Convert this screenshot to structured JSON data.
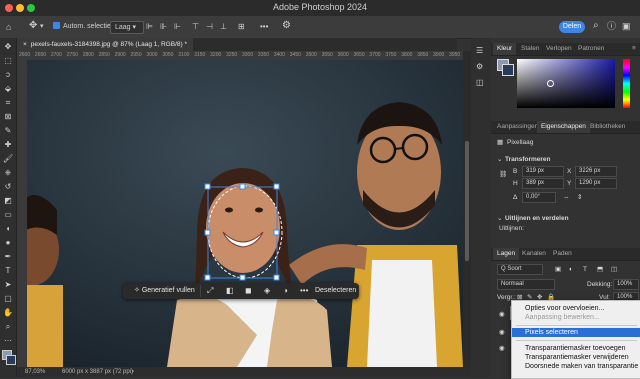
{
  "window": {
    "title": "Adobe Photoshop 2024"
  },
  "options_bar": {
    "auto_select_label": "Autom. selectie:",
    "layer_select_value": "Laag",
    "more_label": "•••",
    "share_label": "Delen"
  },
  "document": {
    "tab_title": "pexels-fauxels-3184398.jpg @ 87% (Laag 1, RGB/8) *",
    "zoom": "87,03%",
    "dimensions": "6000 px x 3887 px (72 ppi)",
    "ruler_marks": [
      "2600",
      "2650",
      "2700",
      "2750",
      "2800",
      "2850",
      "2900",
      "2950",
      "3000",
      "3050",
      "3100",
      "3150",
      "3200",
      "3250",
      "3300",
      "3350",
      "3400",
      "3450",
      "3500",
      "3550",
      "3600",
      "3650",
      "3700",
      "3750",
      "3800",
      "3850",
      "3900",
      "3950"
    ]
  },
  "contextual_task_bar": {
    "generate_label": "Generatief vullen",
    "deselect_label": "Deselecteren",
    "more_label": "•••"
  },
  "color_panel": {
    "tabs": [
      "Kleur",
      "Stalen",
      "Verlopen",
      "Patronen"
    ],
    "active_tab": "Kleur",
    "hue_color": "#1a1aa8"
  },
  "properties_panel": {
    "tabs": [
      "Aanpassingen",
      "Eigenschappen",
      "Bibliotheken"
    ],
    "active_tab": "Eigenschappen",
    "layer_type": "Pixellaag",
    "transform_header": "Transformeren",
    "w_label": "B",
    "w_value": "319 px",
    "h_label": "H",
    "h_value": "389 px",
    "x_label": "X",
    "x_value": "3226 px",
    "y_label": "Y",
    "y_value": "1290 px",
    "angle_label": "Δ",
    "angle_value": "0,00°",
    "align_header": "Uitlijnen en verdelen",
    "align_sub": "Uitlijnen:"
  },
  "layers_panel": {
    "tabs": [
      "Lagen",
      "Kanalen",
      "Paden"
    ],
    "active_tab": "Lagen",
    "filter_label": "Q Soort",
    "blend_mode": "Normaal",
    "opacity_label": "Dekking:",
    "opacity_value": "100%",
    "lock_label": "Vergr.:",
    "fill_label": "Vul:",
    "fill_value": "100%"
  },
  "context_menu": {
    "items": [
      {
        "label": "Opties voor overvloeien...",
        "state": "normal"
      },
      {
        "label": "Aanpassing bewerken...",
        "state": "disabled"
      },
      {
        "label": "Pixels selecteren",
        "state": "highlighted"
      },
      {
        "label": "Transparantiemasker toevoegen",
        "state": "normal"
      },
      {
        "label": "Transparantiemasker verwijderen",
        "state": "normal"
      },
      {
        "label": "Doorsnede maken van transparantie",
        "state": "normal"
      }
    ]
  },
  "colors": {
    "accent": "#3d86e6",
    "menu_highlight": "#2a6fd6",
    "selection_handle": "#3d86e6"
  }
}
